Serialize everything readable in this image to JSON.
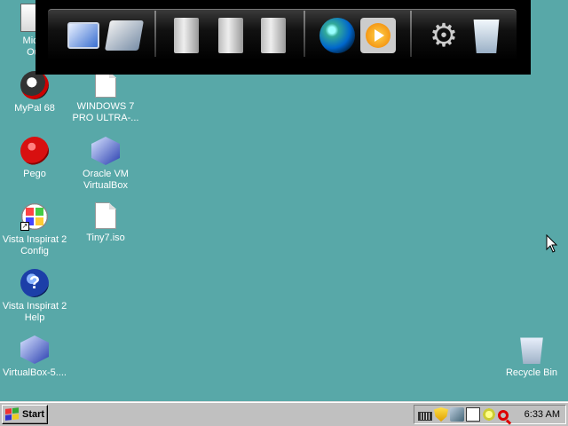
{
  "desktop": {
    "background_color": "#58a8a8",
    "icons": [
      {
        "label": "Micro\nOut",
        "icon": "outlook-icon"
      },
      {
        "label": "MyPal 68",
        "icon": "mypal-browser-icon"
      },
      {
        "label": "WINDOWS 7\nPRO ULTRA-...",
        "icon": "document-icon"
      },
      {
        "label": "Pego",
        "icon": "pego-icon"
      },
      {
        "label": "Oracle VM\nVirtualBox",
        "icon": "virtualbox-icon"
      },
      {
        "label": "Vista Inspirat 2\nConfig",
        "icon": "windows-config-icon"
      },
      {
        "label": "Tiny7.iso",
        "icon": "document-icon"
      },
      {
        "label": "Vista Inspirat 2\nHelp",
        "icon": "help-icon"
      },
      {
        "label": "VirtualBox-5....",
        "icon": "virtualbox-icon"
      },
      {
        "label": "Recycle Bin",
        "icon": "recycle-bin-icon"
      }
    ],
    "help_glyph": "?"
  },
  "dock": {
    "items": [
      {
        "icon": "computer-icon"
      },
      {
        "icon": "network-icon"
      },
      {
        "icon": "folder-icon"
      },
      {
        "icon": "documents-folder-icon"
      },
      {
        "icon": "pictures-folder-icon"
      },
      {
        "icon": "globe-browser-icon"
      },
      {
        "icon": "media-player-icon"
      },
      {
        "icon": "settings-gears-icon"
      },
      {
        "icon": "recycle-bin-icon"
      }
    ],
    "gear_glyph": "⚙"
  },
  "taskbar": {
    "start_label": "Start",
    "tray_icons": [
      "keyboard-icon",
      "security-shield-icon",
      "network-icon",
      "display-icon",
      "volume-icon",
      "search-icon"
    ],
    "clock": "6:33 AM"
  }
}
